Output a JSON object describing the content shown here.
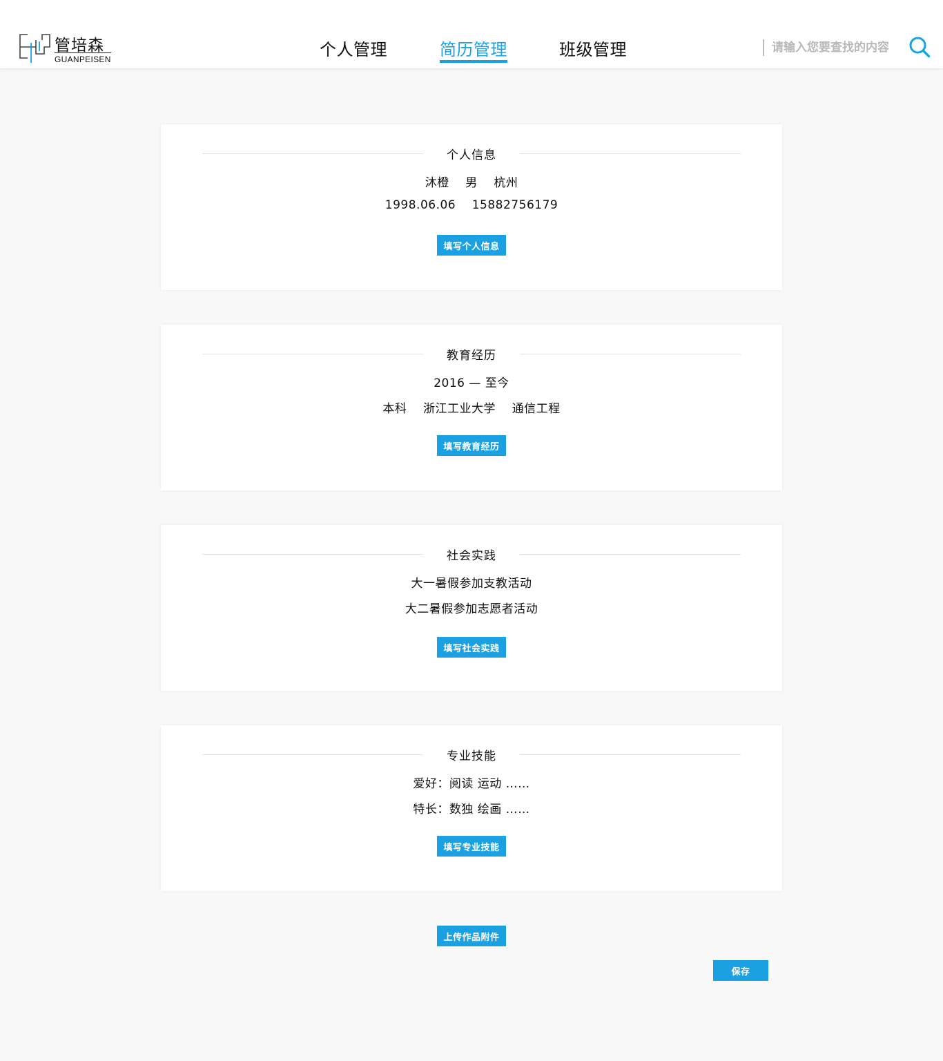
{
  "header": {
    "logo": {
      "cn": "管培森",
      "en": "GUANPEISEN"
    },
    "nav": [
      {
        "label": "个人管理",
        "active": false
      },
      {
        "label": "简历管理",
        "active": true
      },
      {
        "label": "班级管理",
        "active": false
      }
    ],
    "search": {
      "placeholder": "请输入您要查找的内容",
      "value": ""
    }
  },
  "sections": [
    {
      "title": "个人信息",
      "lines": [
        "沐橙    男    杭州",
        "1998.06.06    15882756179"
      ],
      "button": "填写个人信息"
    },
    {
      "title": "教育经历",
      "lines": [
        "2016 — 至今",
        "本科    浙江工业大学    通信工程"
      ],
      "button": "填写教育经历"
    },
    {
      "title": "社会实践",
      "lines": [
        "大一暑假参加支教活动",
        "大二暑假参加志愿者活动"
      ],
      "button": "填写社会实践"
    },
    {
      "title": "专业技能",
      "lines": [
        "爱好：阅读 运动 ……",
        "特长：数独 绘画 ……"
      ],
      "button": "填写专业技能"
    }
  ],
  "actions": {
    "upload": "上传作品附件",
    "save": "保存"
  },
  "colors": {
    "accent": "#1ba1e2",
    "background": "#f8f8f8",
    "card": "#ffffff"
  }
}
